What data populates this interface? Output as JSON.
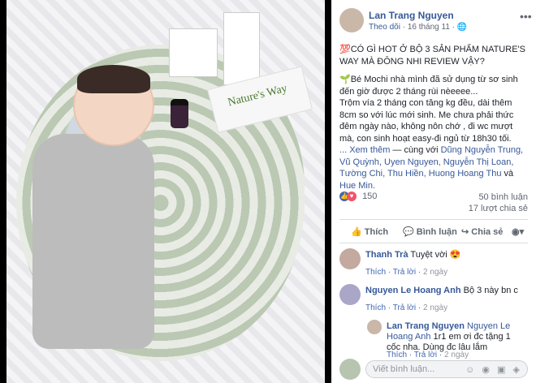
{
  "author": {
    "name": "Lan Trang Nguyen",
    "follow": "Theo dõi",
    "time": "16 tháng 11",
    "more": "•••"
  },
  "post": {
    "line1": "💯CÓ GÌ HOT Ở BỘ 3 SẢN PHẨM NATURE'S WAY MÀ ĐÔNG NHI REVIEW VẬY?",
    "line2": "🌱Bé Mochi nhà mình đã sử dụng từ sơ sinh đến giờ được 2 tháng rùi nèeeee...",
    "line3": "Trộm vía 2 tháng con tăng kg đều, dài thêm 8cm so với lúc mới sinh. Me chưa phải thức đêm ngày nào, không nôn chớ , đi wc mượt mà, con sinh hoạt easy-đi ngủ từ 18h30 tối.",
    "see_more": "... Xem thêm",
    "with_prefix": "— cùng với",
    "tags": "Dũng Nguyễn Trung, Vũ Quỳnh, Uyen Nguyen, Nguyễn Thị Loan, Tường Chi, Thu Hiền, Huong Hoang Thu",
    "and": "và",
    "last_tag": "Hue Min."
  },
  "stats": {
    "reactions": "150",
    "comments": "50 bình luận",
    "shares": "17 lượt chia sẻ"
  },
  "actions": {
    "like": "Thích",
    "comment": "Bình luận",
    "share": "Chia sẻ"
  },
  "comments": [
    {
      "name": "Thanh Trà",
      "text": "Tuyệt vời 😍",
      "like": "Thích",
      "reply": "Trả lời",
      "time": "2 ngày"
    },
    {
      "name": "Nguyen Le Hoang Anh",
      "text": "Bộ 3 này bn c",
      "like": "Thích",
      "reply": "Trả lời",
      "time": "2 ngày"
    },
    {
      "name": "Lan Trang Nguyen",
      "mention": "Nguyen Le Hoang Anh",
      "text": "1r1 em ơi đc tặng 1 cốc nha. Dùng đc lâu lắm",
      "like": "Thích",
      "reply": "Trả lời",
      "time": "2 ngày"
    }
  ],
  "compose": {
    "placeholder": "Viết bình luận...",
    "icons": "☺ ◉ ▣ ◈"
  },
  "photo": {
    "brand_text": "Nature's Way"
  },
  "colors": {
    "link": "#365899",
    "like_icon": "#4267b2",
    "heart_icon": "#f25268"
  }
}
